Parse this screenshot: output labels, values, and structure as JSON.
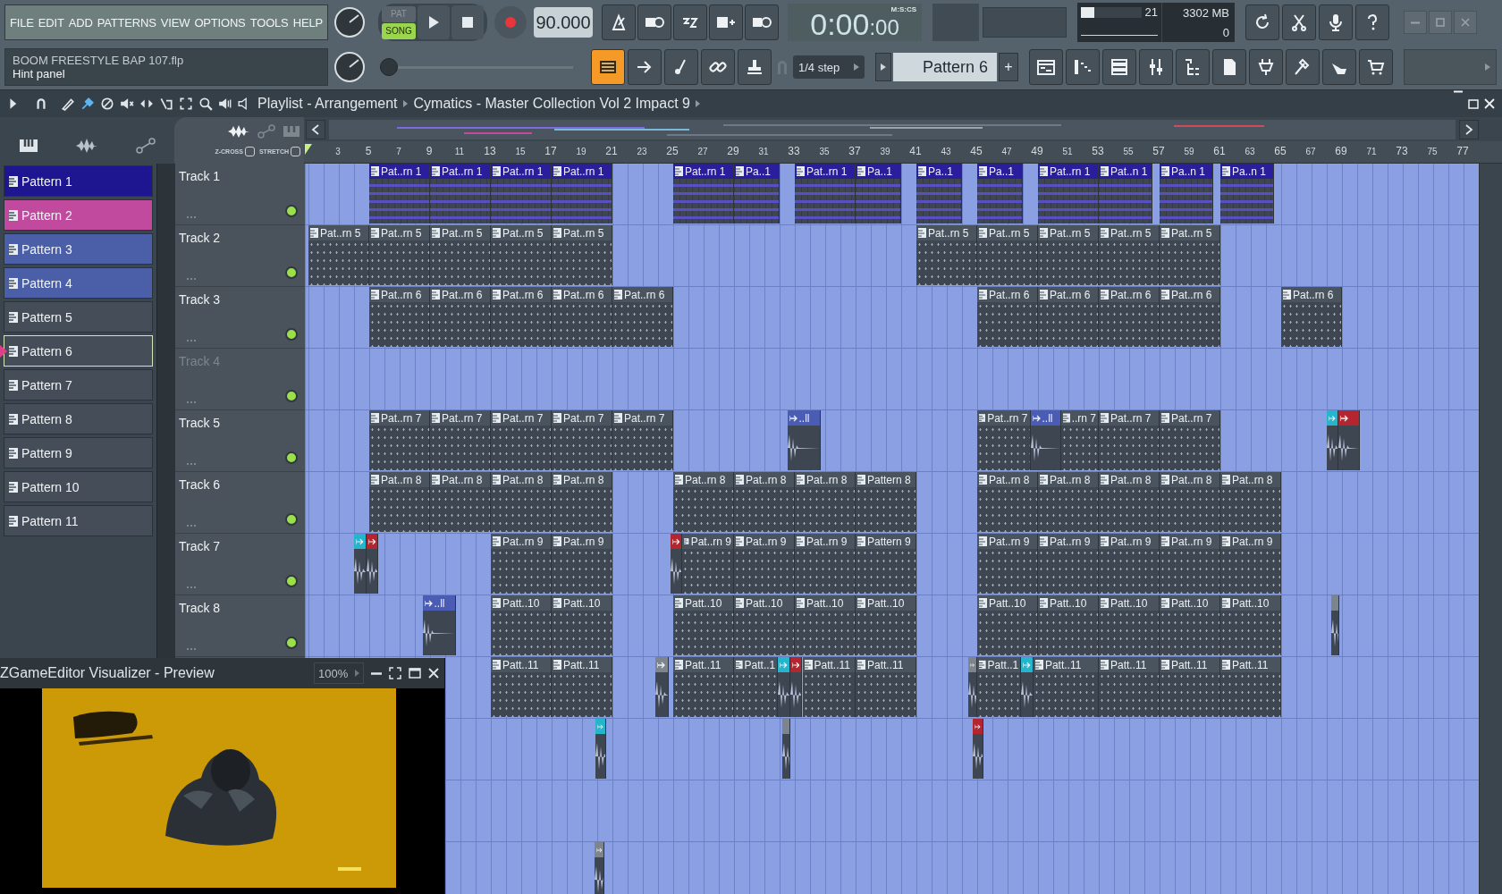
{
  "menu": [
    "FILE",
    "EDIT",
    "ADD",
    "PATTERNS",
    "VIEW",
    "OPTIONS",
    "TOOLS",
    "HELP"
  ],
  "project": {
    "file": "BOOM FREESTYLE BAP 107.flp",
    "hint": "Hint panel"
  },
  "transport": {
    "modes": [
      {
        "label": "PAT",
        "selected": false
      },
      {
        "label": "SONG",
        "selected": true
      }
    ],
    "tempo": "90.000"
  },
  "time": {
    "value": "0:00",
    "centis": ":00",
    "unit": "M:S:CS"
  },
  "monitor": {
    "cpu": {
      "level": 0.22,
      "reading": "21"
    },
    "memory": "3302 MB",
    "polyphony": "0"
  },
  "master_volume": {
    "level": 0.02
  },
  "snap": "1/4 step",
  "pattern_selector": {
    "value": "Pattern 6",
    "add": "+"
  },
  "playlist": {
    "title": "Playlist - Arrangement",
    "path": "Cymatics - Master Collection Vol 2 Impact 9",
    "options": [
      {
        "label": "Z-CROSS",
        "checked": false
      },
      {
        "label": "STRETCH",
        "checked": false
      }
    ],
    "ruler": [
      "3",
      "5",
      "7",
      "9",
      "11",
      "13",
      "15",
      "17",
      "19",
      "21",
      "23",
      "25",
      "27",
      "29",
      "31",
      "33",
      "35",
      "37",
      "39",
      "41",
      "43",
      "45",
      "47",
      "49",
      "51",
      "53",
      "55",
      "57",
      "59",
      "61",
      "63",
      "65",
      "67",
      "69",
      "71",
      "73",
      "75",
      "77"
    ],
    "tracks": [
      {
        "name": "Track 1",
        "disabled": false,
        "on": true,
        "clips": [
          {
            "kind": "pattern",
            "label": "Pat..rn 1",
            "color": "#2b1e9c"
          },
          {
            "kind": "pattern",
            "label": "Pat..rn 1",
            "color": "#2b1e9c"
          },
          {
            "kind": "pattern",
            "label": "Pat..rn 1",
            "color": "#2b1e9c"
          },
          {
            "kind": "pattern",
            "label": "Pat..rn 1",
            "color": "#2b1e9c"
          },
          {
            "kind": "pattern",
            "label": "Pat..rn 1",
            "color": "#2b1e9c"
          },
          {
            "kind": "pattern",
            "label": "Pa..1",
            "color": "#2b1e9c"
          },
          {
            "kind": "pattern",
            "label": "Pat..rn 1",
            "color": "#2b1e9c"
          },
          {
            "kind": "pattern",
            "label": "Pa..1",
            "color": "#2b1e9c"
          },
          {
            "kind": "pattern",
            "label": "Pa..1",
            "color": "#2b1e9c"
          },
          {
            "kind": "pattern",
            "label": "Pa..1",
            "color": "#2b1e9c"
          },
          {
            "kind": "pattern",
            "label": "Pat..rn 1",
            "color": "#2b1e9c"
          },
          {
            "kind": "pattern",
            "label": "Pat..n 1",
            "color": "#2b1e9c"
          },
          {
            "kind": "pattern",
            "label": "Pa..n 1",
            "color": "#2b1e9c"
          },
          {
            "kind": "pattern",
            "label": "Pa..n 1",
            "color": "#2b1e9c"
          }
        ]
      },
      {
        "name": "Track 2",
        "disabled": false,
        "on": true,
        "clips": [
          {
            "kind": "pattern",
            "label": "Pat..rn 5",
            "color": "#4a545f"
          },
          {
            "kind": "pattern",
            "label": "Pat..rn 5",
            "color": "#4a545f"
          },
          {
            "kind": "pattern",
            "label": "Pat..rn 5",
            "color": "#4a545f"
          },
          {
            "kind": "pattern",
            "label": "Pat..rn 5",
            "color": "#4a545f"
          },
          {
            "kind": "pattern",
            "label": "Pat..rn 5",
            "color": "#4a545f"
          },
          {
            "kind": "pattern",
            "label": "Pat..rn 5",
            "color": "#4a545f"
          },
          {
            "kind": "pattern",
            "label": "Pat..rn 5",
            "color": "#4a545f"
          },
          {
            "kind": "pattern",
            "label": "Pat..rn 5",
            "color": "#4a545f"
          },
          {
            "kind": "pattern",
            "label": "Pat..rn 5",
            "color": "#4a545f"
          },
          {
            "kind": "pattern",
            "label": "Pat..rn 5",
            "color": "#4a545f"
          }
        ]
      },
      {
        "name": "Track 3",
        "disabled": false,
        "on": true,
        "clips": [
          {
            "kind": "pattern",
            "label": "Pat..rn 6",
            "color": "#4a545f"
          },
          {
            "kind": "pattern",
            "label": "Pat..rn 6",
            "color": "#4a545f"
          },
          {
            "kind": "pattern",
            "label": "Pat..rn 6",
            "color": "#4a545f"
          },
          {
            "kind": "pattern",
            "label": "Pat..rn 6",
            "color": "#4a545f"
          },
          {
            "kind": "pattern",
            "label": "Pat..rn 6",
            "color": "#4a545f"
          },
          {
            "kind": "pattern",
            "label": "Pat..rn 6",
            "color": "#4a545f"
          },
          {
            "kind": "pattern",
            "label": "Pat..rn 6",
            "color": "#4a545f"
          },
          {
            "kind": "pattern",
            "label": "Pat..rn 6",
            "color": "#4a545f"
          },
          {
            "kind": "pattern",
            "label": "Pat..rn 6",
            "color": "#4a545f"
          },
          {
            "kind": "pattern",
            "label": "Pat..rn 6",
            "color": "#4a545f"
          }
        ]
      },
      {
        "name": "Track 4",
        "disabled": true,
        "on": true
      },
      {
        "name": "Track 5",
        "disabled": false,
        "on": true,
        "clips": [
          {
            "kind": "pattern",
            "label": "Pat..rn 7",
            "color": "#4a545f"
          },
          {
            "kind": "pattern",
            "label": "Pat..rn 7",
            "color": "#4a545f"
          },
          {
            "kind": "pattern",
            "label": "Pat..rn 7",
            "color": "#4a545f"
          },
          {
            "kind": "pattern",
            "label": "Pat..rn 7",
            "color": "#4a545f"
          },
          {
            "kind": "pattern",
            "label": "Pat..rn 7",
            "color": "#4a545f"
          },
          {
            "kind": "audio",
            "label": "..ll",
            "color": "#4b5cb4"
          },
          {
            "kind": "pattern",
            "label": "Pat..rn 7",
            "color": "#4a545f"
          },
          {
            "kind": "audio",
            "label": "..ll",
            "color": "#4b5cb4"
          },
          {
            "kind": "pattern",
            "label": "..rn 7",
            "color": "#4a545f"
          },
          {
            "kind": "pattern",
            "label": "Pat..rn 7",
            "color": "#4a545f"
          },
          {
            "kind": "pattern",
            "label": "Pat..rn 7",
            "color": "#4a545f"
          },
          {
            "kind": "audio",
            "color": "#25b5cc"
          },
          {
            "kind": "audio",
            "color": "#b3262f"
          }
        ]
      },
      {
        "name": "Track 6",
        "disabled": false,
        "on": true,
        "clips": [
          {
            "kind": "pattern",
            "label": "Pat..rn 8",
            "color": "#4a545f"
          },
          {
            "kind": "pattern",
            "label": "Pat..rn 8",
            "color": "#4a545f"
          },
          {
            "kind": "pattern",
            "label": "Pat..rn 8",
            "color": "#4a545f"
          },
          {
            "kind": "pattern",
            "label": "Pat..rn 8",
            "color": "#4a545f"
          },
          {
            "kind": "pattern",
            "label": "Pat..rn 8",
            "color": "#4a545f"
          },
          {
            "kind": "pattern",
            "label": "Pat..rn 8",
            "color": "#4a545f"
          },
          {
            "kind": "pattern",
            "label": "Pat..rn 8",
            "color": "#4a545f"
          },
          {
            "kind": "pattern",
            "label": "Pattern 8",
            "color": "#4a545f"
          },
          {
            "kind": "pattern",
            "label": "Pat..rn 8",
            "color": "#4a545f"
          },
          {
            "kind": "pattern",
            "label": "Pat..rn 8",
            "color": "#4a545f"
          },
          {
            "kind": "pattern",
            "label": "Pat..rn 8",
            "color": "#4a545f"
          },
          {
            "kind": "pattern",
            "label": "Pat..rn 8",
            "color": "#4a545f"
          },
          {
            "kind": "pattern",
            "label": "Pat..rn 8",
            "color": "#4a545f"
          }
        ]
      },
      {
        "name": "Track 7",
        "disabled": false,
        "on": true,
        "clips": [
          {
            "kind": "audio",
            "color": "#25b5cc"
          },
          {
            "kind": "audio",
            "color": "#b3262f"
          },
          {
            "kind": "pattern",
            "label": "Pat..rn 9",
            "color": "#4a545f"
          },
          {
            "kind": "pattern",
            "label": "Pat..rn 9",
            "color": "#4a545f"
          },
          {
            "kind": "audio",
            "color": "#b3262f"
          },
          {
            "kind": "pattern",
            "label": "Pat..rn 9",
            "color": "#4a545f"
          },
          {
            "kind": "pattern",
            "label": "Pat..rn 9",
            "color": "#4a545f"
          },
          {
            "kind": "pattern",
            "label": "Pat..rn 9",
            "color": "#4a545f"
          },
          {
            "kind": "pattern",
            "label": "Pattern 9",
            "color": "#4a545f"
          },
          {
            "kind": "pattern",
            "label": "Pat..rn 9",
            "color": "#4a545f"
          },
          {
            "kind": "pattern",
            "label": "Pat..rn 9",
            "color": "#4a545f"
          },
          {
            "kind": "pattern",
            "label": "Pat..rn 9",
            "color": "#4a545f"
          },
          {
            "kind": "pattern",
            "label": "Pat..rn 9",
            "color": "#4a545f"
          },
          {
            "kind": "pattern",
            "label": "Pat..rn 9",
            "color": "#4a545f"
          }
        ]
      },
      {
        "name": "Track 8",
        "disabled": false,
        "on": true,
        "clips": [
          {
            "kind": "audio",
            "label": "..ll",
            "color": "#4b5cb4"
          },
          {
            "kind": "pattern",
            "label": "Patt..10",
            "color": "#4a545f"
          },
          {
            "kind": "pattern",
            "label": "Patt..10",
            "color": "#4a545f"
          },
          {
            "kind": "pattern",
            "label": "Patt..10",
            "color": "#4a545f"
          },
          {
            "kind": "pattern",
            "label": "Patt..10",
            "color": "#4a545f"
          },
          {
            "kind": "pattern",
            "label": "Patt..10",
            "color": "#4a545f"
          },
          {
            "kind": "pattern",
            "label": "Patt..10",
            "color": "#4a545f"
          },
          {
            "kind": "pattern",
            "label": "Patt..10",
            "color": "#4a545f"
          },
          {
            "kind": "pattern",
            "label": "Patt..10",
            "color": "#4a545f"
          },
          {
            "kind": "pattern",
            "label": "Patt..10",
            "color": "#4a545f"
          },
          {
            "kind": "pattern",
            "label": "Patt..10",
            "color": "#4a545f"
          },
          {
            "kind": "pattern",
            "label": "Patt..10",
            "color": "#4a545f"
          },
          {
            "kind": "audio",
            "color": "#7d848c"
          }
        ]
      },
      {
        "clips": [
          {
            "kind": "pattern",
            "label": "Patt..11",
            "color": "#4a545f"
          },
          {
            "kind": "pattern",
            "label": "Patt..11",
            "color": "#4a545f"
          },
          {
            "kind": "audio",
            "color": "#7d848c"
          },
          {
            "kind": "pattern",
            "label": "Patt..11",
            "color": "#4a545f"
          },
          {
            "kind": "pattern",
            "label": "Patt..1",
            "color": "#4a545f"
          },
          {
            "kind": "audio",
            "color": "#25b5cc"
          },
          {
            "kind": "audio",
            "color": "#b3262f"
          },
          {
            "kind": "pattern",
            "label": "Patt..11",
            "color": "#4a545f"
          },
          {
            "kind": "pattern",
            "label": "Patt..11",
            "color": "#4a545f"
          },
          {
            "kind": "audio",
            "color": "#7d848c"
          },
          {
            "kind": "pattern",
            "label": "Patt..1",
            "color": "#4a545f"
          },
          {
            "kind": "audio",
            "color": "#25b5cc"
          },
          {
            "kind": "pattern",
            "label": "Patt..11",
            "color": "#4a545f"
          },
          {
            "kind": "pattern",
            "label": "Patt..11",
            "color": "#4a545f"
          },
          {
            "kind": "pattern",
            "label": "Patt..11",
            "color": "#4a545f"
          },
          {
            "kind": "pattern",
            "label": "Patt..11",
            "color": "#4a545f"
          }
        ]
      },
      {
        "clips": [
          {
            "kind": "audio",
            "color": "#25b5cc"
          },
          {
            "kind": "audio",
            "color": "#7d848c"
          },
          {
            "kind": "audio",
            "color": "#b3262f"
          }
        ]
      },
      {
        "clips": [
          {
            "kind": "audio",
            "color": "#7d848c"
          }
        ]
      }
    ]
  },
  "patterns": [
    {
      "label": "Pattern 1",
      "color": "#1e1590",
      "selected": false
    },
    {
      "label": "Pattern 2",
      "color": "#c24a9e",
      "selected": false
    },
    {
      "label": "Pattern 3",
      "color": "#4b5ea8",
      "selected": false
    },
    {
      "label": "Pattern 4",
      "color": "#4b5ea8",
      "selected": false
    },
    {
      "label": "Pattern 5",
      "color": "#454e58",
      "selected": false
    },
    {
      "label": "Pattern 6",
      "color": "#454e58",
      "selected": true
    },
    {
      "label": "Pattern 7",
      "color": "#454e58",
      "selected": false
    },
    {
      "label": "Pattern 8",
      "color": "#454e58",
      "selected": false
    },
    {
      "label": "Pattern 9",
      "color": "#454e58",
      "selected": false
    },
    {
      "label": "Pattern 10",
      "color": "#454e58",
      "selected": false
    },
    {
      "label": "Pattern 11",
      "color": "#454e58",
      "selected": false
    }
  ],
  "visualizer": {
    "title": "ZGameEditor Visualizer - Preview",
    "zoom": "100%"
  }
}
